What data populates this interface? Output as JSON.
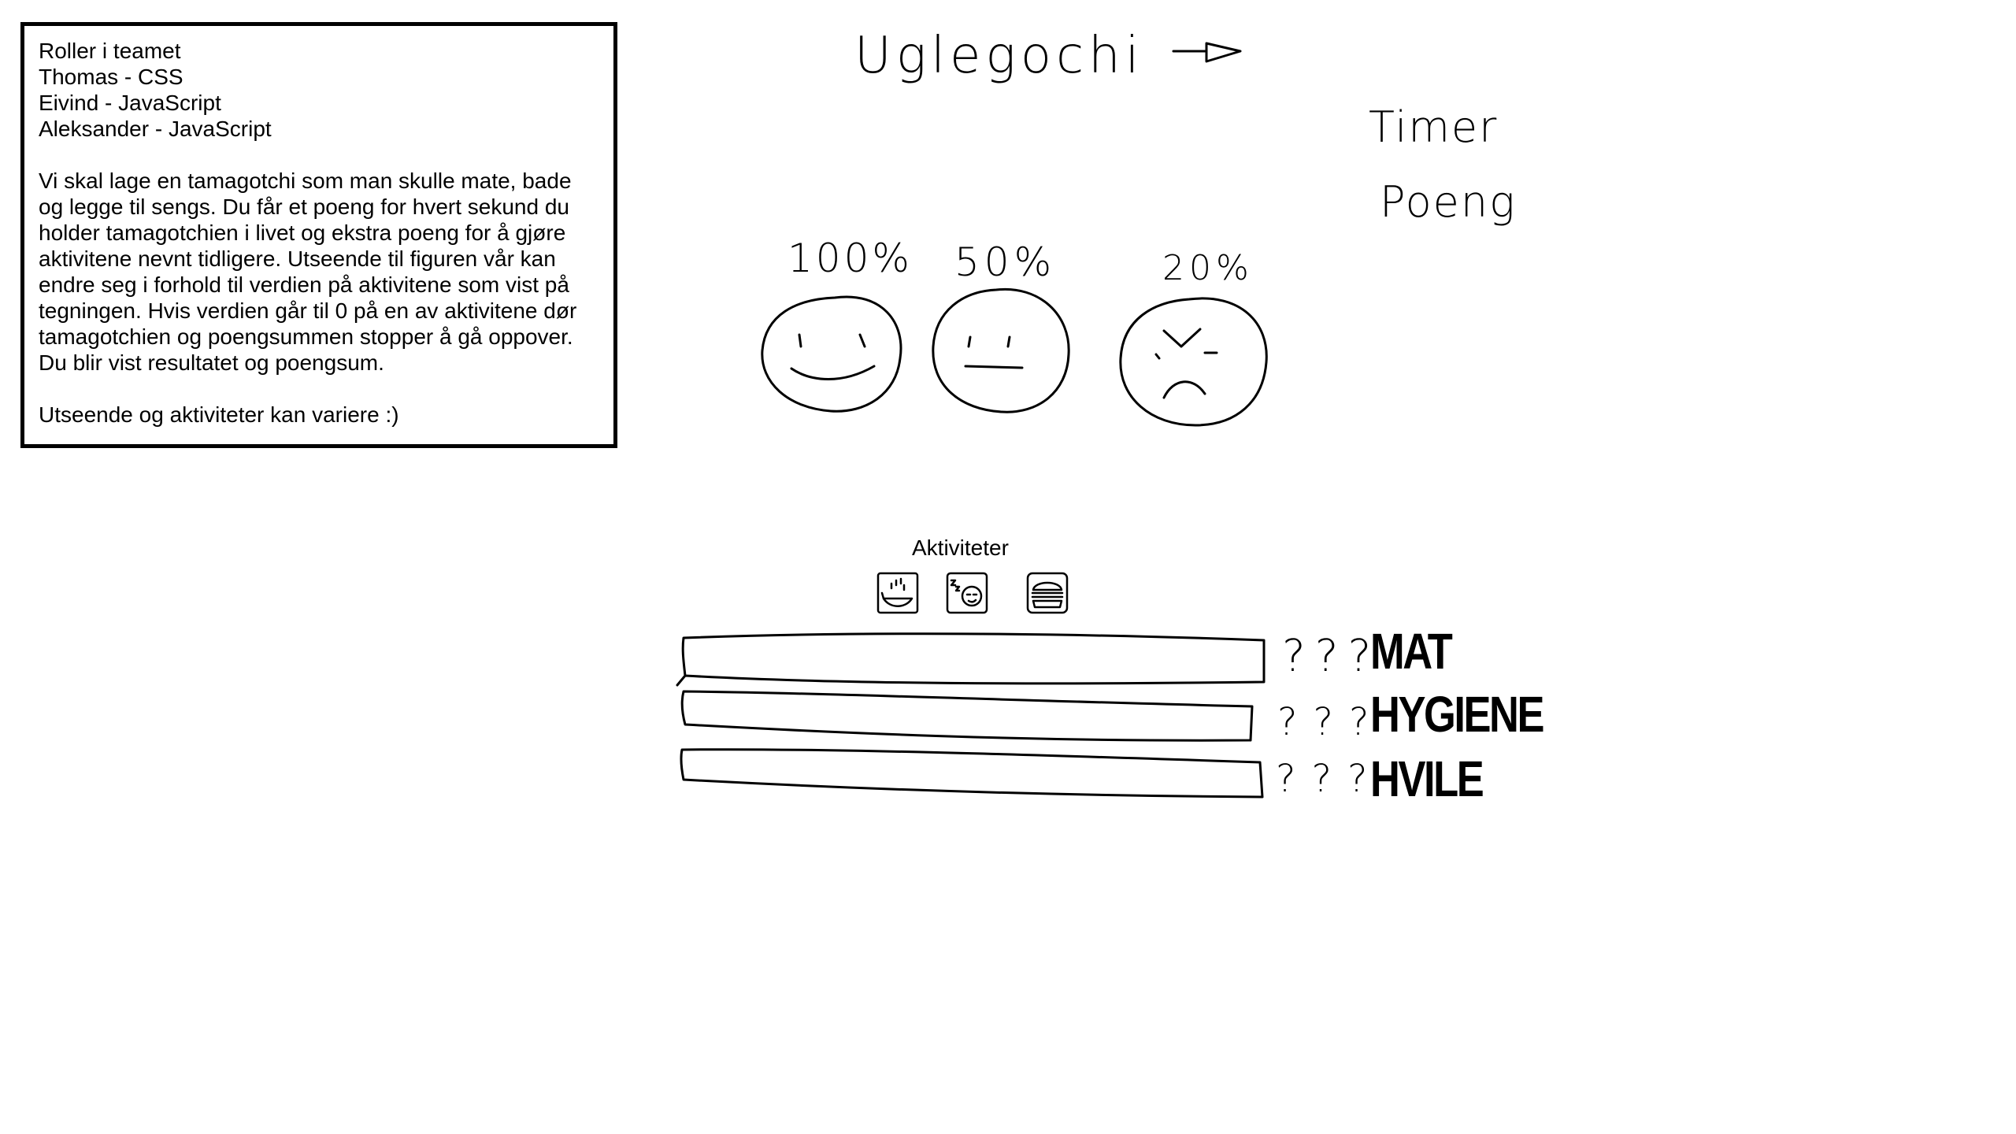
{
  "info": {
    "roles_title": "Roller i teamet",
    "role_1": "Thomas - CSS",
    "role_2": "Eivind - JavaScript",
    "role_3": "Aleksander - JavaScript",
    "desc_lines": [
      "Vi skal lage en tamagotchi som man skulle mate, bade",
      "og legge til sengs. Du får et poeng for hvert sekund du",
      "holder tamagotchien i livet og ekstra poeng for å gjøre",
      "aktivitene nevnt tidligere. Utseende til figuren vår kan",
      "endre seg i forhold til verdien på aktivitene som vist på",
      "tegningen. Hvis verdien går til 0 på en av aktivitene dør",
      "tamagotchien og poengsummen stopper å gå oppover.",
      "Du blir vist resultatet og poengsum."
    ],
    "footer": "Utseende og aktiviteter kan variere :)"
  },
  "sketch": {
    "title": "Uglegochi",
    "timer_label": "Timer",
    "score_label": "Poeng",
    "faces": [
      {
        "percent": "100%",
        "mood": "happy"
      },
      {
        "percent": "50%",
        "mood": "neutral"
      },
      {
        "percent": "20%",
        "mood": "angry"
      }
    ]
  },
  "activities": {
    "label": "Aktiviteter",
    "icons": [
      "bath-icon",
      "sleep-icon",
      "burger-icon"
    ]
  },
  "stats": [
    {
      "name": "MAT",
      "value_text": "???"
    },
    {
      "name": "HYGIENE",
      "value_text": "???"
    },
    {
      "name": "HVILE",
      "value_text": "???"
    }
  ]
}
